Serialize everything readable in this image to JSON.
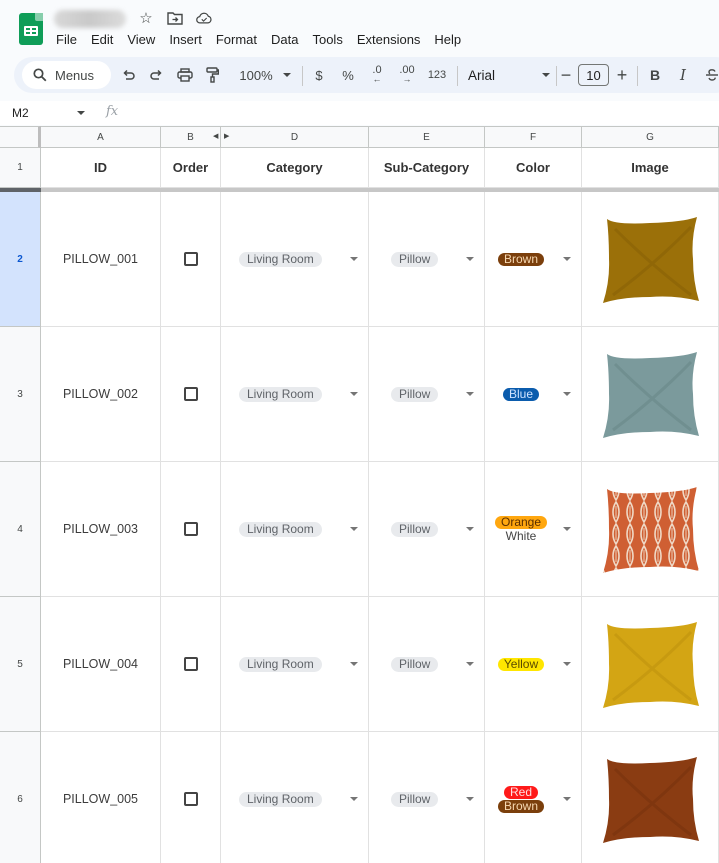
{
  "app": {
    "name": "Google Sheets",
    "brand_color": "#0f9d58",
    "title_icons": [
      "star-icon",
      "move-to-folder-icon",
      "cloud-saved-icon"
    ]
  },
  "menubar": {
    "items": [
      "File",
      "Edit",
      "View",
      "Insert",
      "Format",
      "Data",
      "Tools",
      "Extensions",
      "Help"
    ]
  },
  "toolbar": {
    "search_label": "Menus",
    "zoom": "100%",
    "currency": "$",
    "percent": "%",
    "decrease_decimal": ".0",
    "increase_decimal": ".00",
    "number_format": "123",
    "font": "Arial",
    "font_size": "10",
    "minus": "−",
    "plus": "+",
    "bold": "B",
    "italic": "I"
  },
  "formula_bar": {
    "name_box": "M2",
    "fx": "fx",
    "value": ""
  },
  "grid": {
    "columns": [
      {
        "letter": "A",
        "header": "ID"
      },
      {
        "letter": "B",
        "header": "Order"
      },
      {
        "letter": "D",
        "header": "Category"
      },
      {
        "letter": "E",
        "header": "Sub-Category"
      },
      {
        "letter": "F",
        "header": "Color"
      },
      {
        "letter": "G",
        "header": "Image"
      }
    ],
    "header_row_number": "1",
    "active_row": "2",
    "rows": [
      {
        "row": "2",
        "id": "PILLOW_001",
        "order": false,
        "category": "Living Room",
        "subcategory": "Pillow",
        "colors": [
          {
            "label": "Brown",
            "bg": "#7b3f0c",
            "fg": "#f6d7b0"
          }
        ],
        "image": {
          "desc": "mustard velvet pillow",
          "fill": "#9b7009",
          "shade": "#7a5606"
        }
      },
      {
        "row": "3",
        "id": "PILLOW_002",
        "order": false,
        "category": "Living Room",
        "subcategory": "Pillow",
        "colors": [
          {
            "label": "Blue",
            "bg": "#0b5cad",
            "fg": "#cfe3ff"
          }
        ],
        "image": {
          "desc": "grey-blue pillow",
          "fill": "#7b9a9c",
          "shade": "#5c7a7c"
        }
      },
      {
        "row": "4",
        "id": "PILLOW_003",
        "order": false,
        "category": "Living Room",
        "subcategory": "Pillow",
        "colors": [
          {
            "label": "Orange",
            "bg": "#ffa70f",
            "fg": "#5a2e00"
          },
          {
            "label": "White",
            "bg": "",
            "fg": "#444444"
          }
        ],
        "image": {
          "desc": "orange and white ikat pillow",
          "fill": "#cf5f33",
          "shade": "#f0d9c6"
        }
      },
      {
        "row": "5",
        "id": "PILLOW_004",
        "order": false,
        "category": "Living Room",
        "subcategory": "Pillow",
        "colors": [
          {
            "label": "Yellow",
            "bg": "#ffe600",
            "fg": "#5a4a00"
          }
        ],
        "image": {
          "desc": "golden yellow pillow",
          "fill": "#d3a514",
          "shade": "#b28608"
        }
      },
      {
        "row": "6",
        "id": "PILLOW_005",
        "order": false,
        "category": "Living Room",
        "subcategory": "Pillow",
        "colors": [
          {
            "label": "Red",
            "bg": "#ff1a1a",
            "fg": "#ffe0e0"
          },
          {
            "label": "Brown",
            "bg": "#7b3f0c",
            "fg": "#f6d7b0"
          }
        ],
        "image": {
          "desc": "rust brown velvet pillow",
          "fill": "#8a3c12",
          "shade": "#6b2c0b"
        }
      }
    ]
  }
}
